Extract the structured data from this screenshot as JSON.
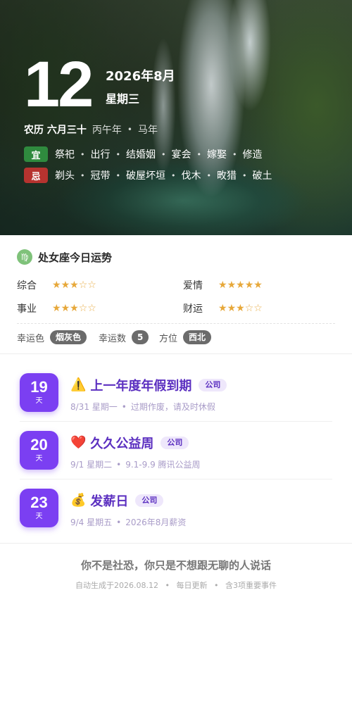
{
  "hero": {
    "day": "12",
    "year_month": "2026年8月",
    "weekday": "星期三",
    "lunar_label": "农历 六月三十",
    "ganzhi_year": "丙午年",
    "zodiac_year": "马年",
    "yi_label": "宜",
    "yi_items": [
      "祭祀",
      "出行",
      "结婚姻",
      "宴会",
      "嫁娶",
      "修造"
    ],
    "ji_label": "忌",
    "ji_items": [
      "剃头",
      "冠带",
      "破屋坏垣",
      "伐木",
      "畋猎",
      "破土"
    ]
  },
  "horoscope": {
    "icon": "virgo-icon",
    "title": "处女座今日运势",
    "stats": [
      {
        "label": "综合",
        "stars": 3,
        "max": 5
      },
      {
        "label": "爱情",
        "stars": 5,
        "max": 5
      },
      {
        "label": "事业",
        "stars": 3,
        "max": 5
      },
      {
        "label": "财运",
        "stars": 3,
        "max": 5
      }
    ],
    "lucky_color_label": "幸运色",
    "lucky_color": "烟灰色",
    "lucky_number_label": "幸运数",
    "lucky_number": "5",
    "direction_label": "方位",
    "direction": "西北"
  },
  "events": [
    {
      "days": "19",
      "unit": "天",
      "emoji": "⚠️",
      "title": "上一年度年假到期",
      "tag": "公司",
      "date": "8/31 星期一",
      "desc": "过期作废，请及时休假"
    },
    {
      "days": "20",
      "unit": "天",
      "emoji": "❤️",
      "title": "久久公益周",
      "tag": "公司",
      "date": "9/1 星期二",
      "desc": "9.1-9.9 腾讯公益周"
    },
    {
      "days": "23",
      "unit": "天",
      "emoji": "💰",
      "title": "发薪日",
      "tag": "公司",
      "date": "9/4 星期五",
      "desc": "2026年8月薪资"
    }
  ],
  "footer": {
    "quote": "你不是社恐，你只是不想跟无聊的人说话",
    "generated": "自动生成于2026.08.12",
    "update": "每日更新",
    "count": "含3项重要事件"
  },
  "colors": {
    "accent": "#7b3ff2",
    "accent_text": "#5b2fc0",
    "star": "#e7a83a",
    "yi": "#2f8a3e",
    "ji": "#b6332f"
  }
}
